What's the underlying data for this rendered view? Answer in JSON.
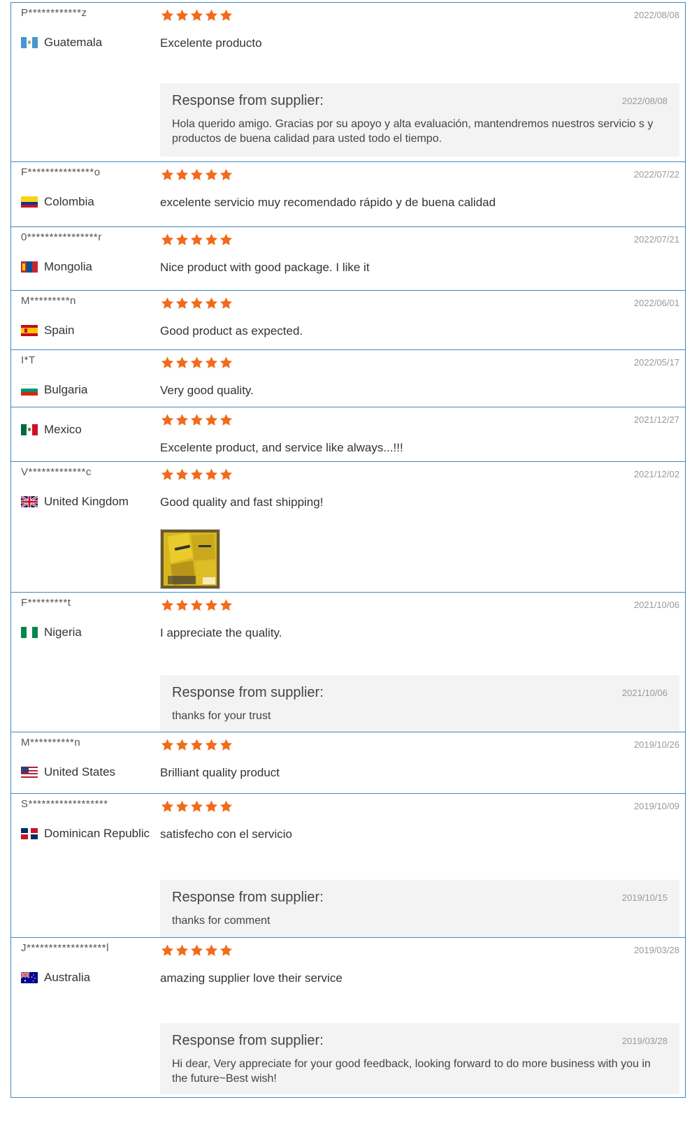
{
  "star_color": "#f26a1b",
  "border_color": "#3d89c6",
  "reviews": [
    {
      "buyer": "P************z",
      "country": "Guatemala",
      "flag": "guatemala",
      "rating": 5,
      "date": "2022/08/08",
      "text": "Excelente producto",
      "response": {
        "title": "Response from supplier:",
        "date": "2022/08/08",
        "text": "Hola querido amigo. Gracias por su apoyo y alta evaluación, mantendremos nuestros servicio s y productos de buena calidad para usted todo el tiempo."
      }
    },
    {
      "buyer": "F***************o",
      "country": "Colombia",
      "flag": "colombia",
      "rating": 5,
      "date": "2022/07/22",
      "text": "excelente servicio muy recomendado rápido y de buena calidad"
    },
    {
      "buyer": "0****************r",
      "country": "Mongolia",
      "flag": "mongolia",
      "rating": 5,
      "date": "2022/07/21",
      "text": "Nice product with good package. I like it"
    },
    {
      "buyer": "M*********n",
      "country": "Spain",
      "flag": "spain",
      "rating": 5,
      "date": "2022/06/01",
      "text": "Good product as expected."
    },
    {
      "buyer": "I*T",
      "country": "Bulgaria",
      "flag": "bulgaria",
      "rating": 5,
      "date": "2022/05/17",
      "text": "Very good quality."
    },
    {
      "buyer": "",
      "country": "Mexico",
      "flag": "mexico",
      "rating": 5,
      "date": "2021/12/27",
      "text": "Excelente product, and service like always...!!!"
    },
    {
      "buyer": "V*************c",
      "country": "United Kingdom",
      "flag": "uk",
      "rating": 5,
      "date": "2021/12/02",
      "text": "Good quality and fast shipping!",
      "has_photo": true
    },
    {
      "buyer": "F*********t",
      "country": "Nigeria",
      "flag": "nigeria",
      "rating": 5,
      "date": "2021/10/06",
      "text": "I appreciate the quality.",
      "response": {
        "title": "Response from supplier:",
        "date": "2021/10/06",
        "text": "thanks for your trust"
      }
    },
    {
      "buyer": "M**********n",
      "country": "United States",
      "flag": "usa",
      "rating": 5,
      "date": "2019/10/26",
      "text": "Brilliant quality product"
    },
    {
      "buyer": "S******************",
      "country": "Dominican Republic",
      "flag": "dominican",
      "rating": 5,
      "date": "2019/10/09",
      "text": "satisfecho con el servicio",
      "response": {
        "title": "Response from supplier:",
        "date": "2019/10/15",
        "text": "thanks for comment"
      }
    },
    {
      "buyer": "J******************l",
      "country": "Australia",
      "flag": "australia",
      "rating": 5,
      "date": "2019/03/28",
      "text": "amazing supplier love their service",
      "response": {
        "title": "Response from supplier:",
        "date": "2019/03/28",
        "text": "Hi dear, Very appreciate for your good feedback, looking forward to do more business with you in the future~Best wish!"
      }
    }
  ]
}
